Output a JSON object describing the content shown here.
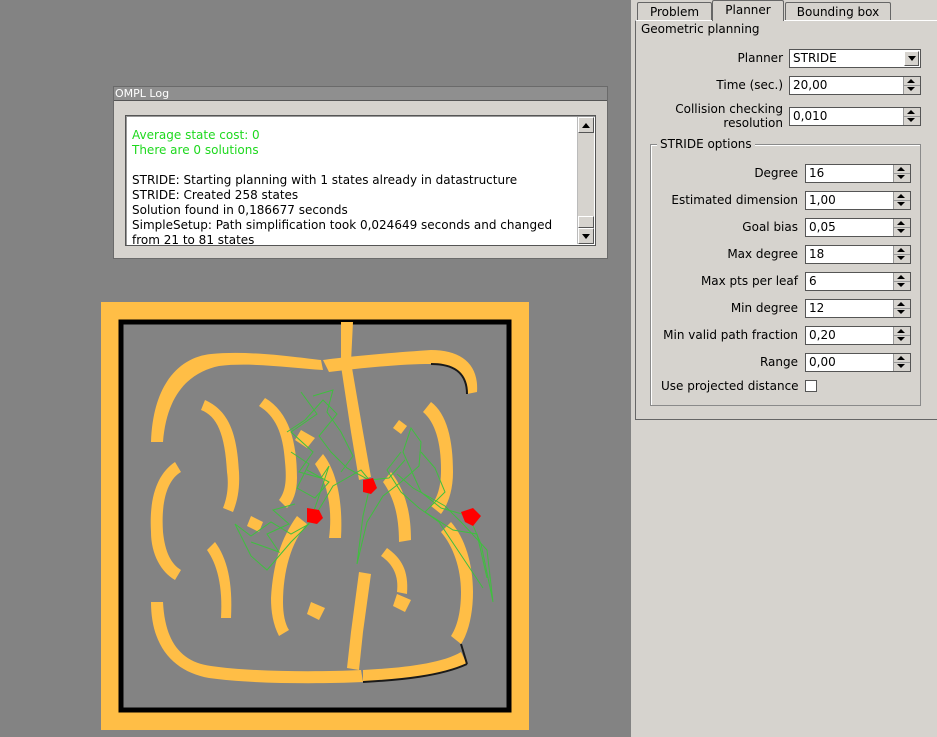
{
  "log": {
    "title": "OMPL Log",
    "lines": [
      {
        "text": "Average state cost: 0",
        "color": "green"
      },
      {
        "text": "There are 0 solutions",
        "color": "green"
      },
      {
        "text": "",
        "color": "black"
      },
      {
        "text": "STRIDE: Starting planning with 1 states already in datastructure",
        "color": "black"
      },
      {
        "text": "STRIDE: Created 258 states",
        "color": "black"
      },
      {
        "text": "Solution found in 0,186677 seconds",
        "color": "black"
      },
      {
        "text": "SimpleSetup: Path simplification took 0,024649 seconds and changed from 21 to 81 states",
        "color": "black"
      }
    ]
  },
  "tabs": [
    {
      "label": "Problem",
      "active": false
    },
    {
      "label": "Planner",
      "active": true
    },
    {
      "label": "Bounding box",
      "active": false
    }
  ],
  "planner": {
    "section_title": "Geometric planning",
    "planner_label": "Planner",
    "planner_value": "STRIDE",
    "time_label": "Time (sec.)",
    "time_value": "20,00",
    "collision_label": "Collision checking resolution",
    "collision_value": "0,010",
    "options_title": "STRIDE options",
    "options": [
      {
        "label": "Degree",
        "value": "16"
      },
      {
        "label": "Estimated dimension",
        "value": "1,00"
      },
      {
        "label": "Goal bias",
        "value": "0,05"
      },
      {
        "label": "Max degree",
        "value": "18"
      },
      {
        "label": "Max pts per leaf",
        "value": "6"
      },
      {
        "label": "Min degree",
        "value": "12"
      },
      {
        "label": "Min valid path fraction",
        "value": "0,20"
      },
      {
        "label": "Range",
        "value": "0,00"
      }
    ],
    "projected_label": "Use projected distance",
    "projected_checked": false
  },
  "colors": {
    "maze_wall": "#ffbe46",
    "maze_floor": "#838383",
    "maze_border": "#000000",
    "path": "#3fbf3f",
    "robot": "#ff0000",
    "log_green": "#1ed81e"
  }
}
